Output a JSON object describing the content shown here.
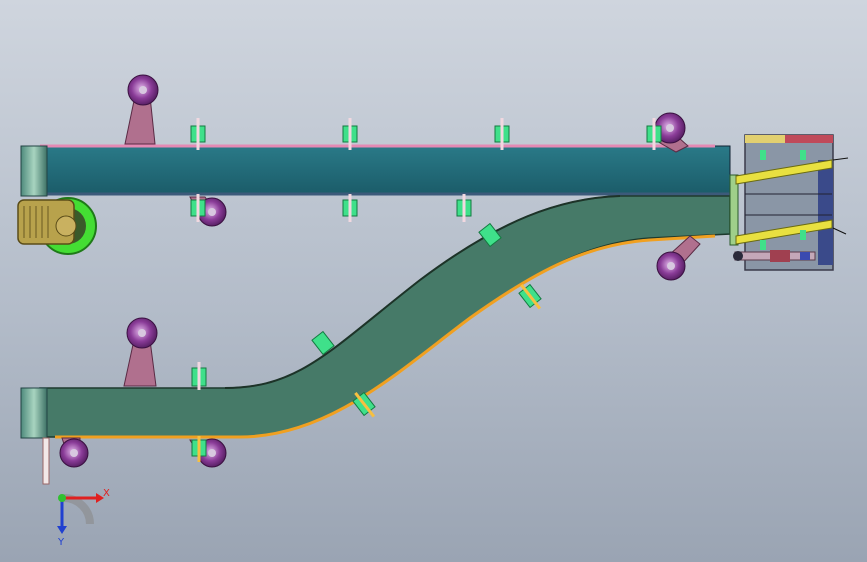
{
  "viewport": {
    "background_top": "#cfd5de",
    "background_bottom": "#9aa4b3"
  },
  "colors": {
    "belt_top": "#1f6674",
    "belt_lower": "#467a68",
    "rail_pink": "#e48ab4",
    "rail_orange": "#f0a020",
    "roller_purple": "#7a2f86",
    "bracket_mauve": "#b0708e",
    "clamp_green": "#3fe08a",
    "drive_motor": "#b8a24c",
    "drive_ring": "#44dd33",
    "tensioner_yellow": "#e8e040"
  },
  "triad": {
    "x_label": "X",
    "y_label": "Y",
    "x_color": "#e02020",
    "y_color": "#2040d0",
    "origin_color": "#30c030"
  }
}
